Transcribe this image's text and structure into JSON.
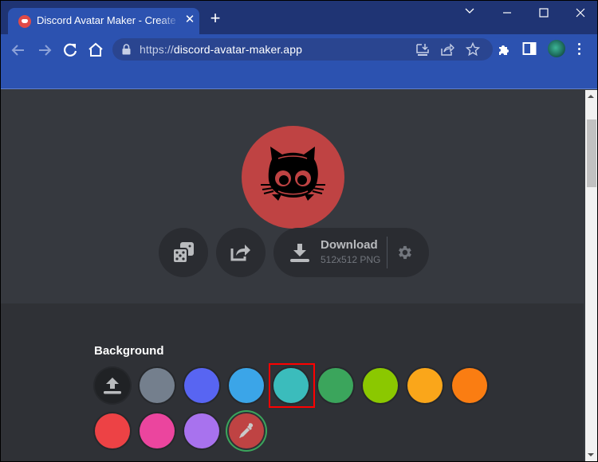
{
  "browser": {
    "tab": {
      "title": "Discord Avatar Maker - Create your own avatar",
      "favicon": "discord-icon"
    },
    "new_tab_label": "+",
    "window_controls": [
      "tab-search",
      "minimize",
      "maximize",
      "close"
    ],
    "address_bar": {
      "scheme": "https://",
      "host": "discord-avatar-maker.app"
    },
    "toolbar_icons": [
      "back",
      "forward",
      "reload",
      "home",
      "lock",
      "install-app",
      "share",
      "bookmark-star",
      "extensions",
      "side-panel",
      "profile",
      "menu"
    ]
  },
  "preview": {
    "avatar_icon": "cat-face-icon",
    "avatar_color": "#bf4343"
  },
  "actions": {
    "randomize_icon": "dice-icon",
    "share_icon": "share-icon",
    "download": {
      "label": "Download",
      "sublabel": "512x512 PNG",
      "settings_icon": "gear-icon"
    }
  },
  "background_section": {
    "title": "Background",
    "selected_index": 4,
    "swatches": [
      {
        "type": "upload",
        "icon": "upload-icon"
      },
      {
        "type": "color",
        "color": "#747f8d"
      },
      {
        "type": "color",
        "color": "#5865f2"
      },
      {
        "type": "color",
        "color": "#3ba5e8"
      },
      {
        "type": "color",
        "color": "#3bbcbc"
      },
      {
        "type": "color",
        "color": "#3ba55c"
      },
      {
        "type": "color",
        "color": "#8bc800"
      },
      {
        "type": "color",
        "color": "#faa61a"
      },
      {
        "type": "color",
        "color": "#fa7d12"
      },
      {
        "type": "color",
        "color": "#ed4245"
      },
      {
        "type": "color",
        "color": "#eb459e"
      },
      {
        "type": "color",
        "color": "#a872ee"
      },
      {
        "type": "picker",
        "color": "#bf4343",
        "icon": "eyedropper-icon"
      }
    ]
  }
}
